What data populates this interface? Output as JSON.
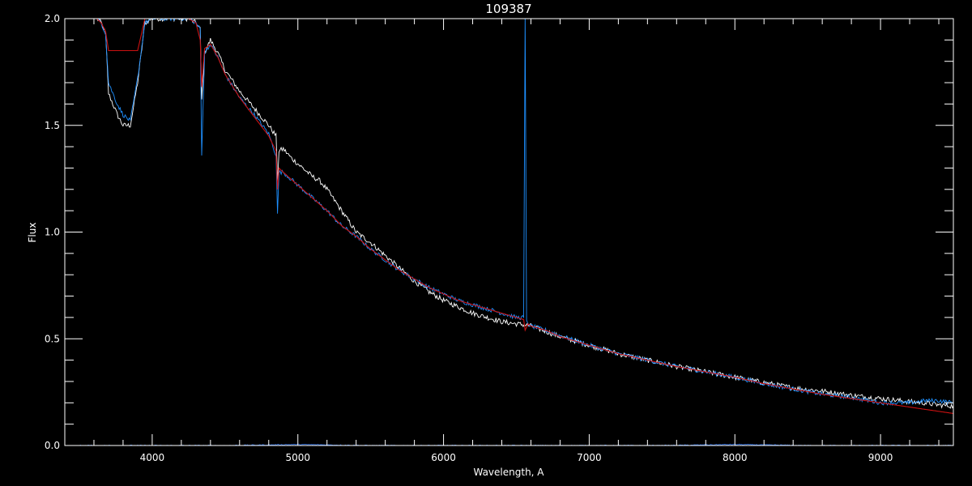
{
  "chart_data": {
    "type": "line",
    "title": "109387",
    "xlabel": "Wavelength, A",
    "ylabel": "Flux",
    "xlim": [
      3400,
      9500
    ],
    "ylim": [
      0.0,
      2.0
    ],
    "xticks": [
      {
        "value": 4000,
        "label": "4000"
      },
      {
        "value": 5000,
        "label": "5000"
      },
      {
        "value": 6000,
        "label": "6000"
      },
      {
        "value": 7000,
        "label": "7000"
      },
      {
        "value": 8000,
        "label": "8000"
      },
      {
        "value": 9000,
        "label": "9000"
      }
    ],
    "yticks": [
      {
        "value": 0.0,
        "label": "0.0"
      },
      {
        "value": 0.5,
        "label": "0.5"
      },
      {
        "value": 1.0,
        "label": "1.0"
      },
      {
        "value": 1.5,
        "label": "1.5"
      },
      {
        "value": 2.0,
        "label": "2.0"
      }
    ],
    "background": "#000000",
    "axis_color": "#ffffff",
    "grid": false,
    "series": [
      {
        "color": "#ffffff",
        "noise": 0.012,
        "x": [
          3620,
          3650,
          3680,
          3700,
          3730,
          3760,
          3800,
          3850,
          3900,
          3950,
          4000,
          4050,
          4100,
          4150,
          4200,
          4250,
          4300,
          4330,
          4340,
          4360,
          4400,
          4450,
          4500,
          4600,
          4700,
          4800,
          4850,
          4860,
          4870,
          4900,
          4950,
          5000,
          5050,
          5100,
          5150,
          5200,
          5250,
          5300,
          5400,
          5500,
          5600,
          5700,
          5800,
          5900,
          6000,
          6100,
          6200,
          6300,
          6400,
          6500,
          6560,
          6600,
          6700,
          6800,
          7000,
          7200,
          7400,
          7600,
          7800,
          8000,
          8200,
          8400,
          8600,
          8800,
          9000,
          9200,
          9300,
          9400,
          9500
        ],
        "y": [
          2.0,
          1.98,
          1.93,
          1.65,
          1.6,
          1.55,
          1.5,
          1.5,
          1.7,
          1.98,
          2.0,
          2.0,
          2.0,
          2.0,
          2.0,
          2.0,
          1.98,
          1.95,
          1.62,
          1.84,
          1.9,
          1.84,
          1.76,
          1.66,
          1.58,
          1.5,
          1.45,
          1.24,
          1.38,
          1.39,
          1.35,
          1.32,
          1.29,
          1.26,
          1.24,
          1.2,
          1.15,
          1.1,
          1.0,
          0.95,
          0.89,
          0.83,
          0.77,
          0.72,
          0.68,
          0.65,
          0.62,
          0.6,
          0.58,
          0.57,
          0.565,
          0.56,
          0.535,
          0.51,
          0.47,
          0.43,
          0.4,
          0.37,
          0.345,
          0.32,
          0.295,
          0.27,
          0.255,
          0.235,
          0.22,
          0.205,
          0.2,
          0.19,
          0.185
        ]
      },
      {
        "color": "#1e90ff",
        "noise": 0.01,
        "x": [
          3620,
          3650,
          3680,
          3700,
          3730,
          3760,
          3800,
          3850,
          3900,
          3950,
          4000,
          4050,
          4100,
          4150,
          4200,
          4250,
          4300,
          4330,
          4340,
          4360,
          4400,
          4450,
          4500,
          4600,
          4700,
          4800,
          4850,
          4860,
          4870,
          4900,
          4950,
          5000,
          5100,
          5200,
          5300,
          5400,
          5500,
          5600,
          5700,
          5800,
          5900,
          6000,
          6100,
          6200,
          6300,
          6400,
          6500,
          6550,
          6560,
          6570,
          6600,
          6700,
          6800,
          7000,
          7200,
          7400,
          7600,
          7800,
          8000,
          8200,
          8400,
          8600,
          8800,
          9000,
          9200,
          9300,
          9400,
          9500
        ],
        "y": [
          2.0,
          1.98,
          1.93,
          1.7,
          1.65,
          1.6,
          1.55,
          1.52,
          1.72,
          1.98,
          2.0,
          2.0,
          2.0,
          2.0,
          2.0,
          2.0,
          1.98,
          1.95,
          1.36,
          1.84,
          1.88,
          1.82,
          1.74,
          1.63,
          1.55,
          1.46,
          1.36,
          1.08,
          1.28,
          1.28,
          1.25,
          1.22,
          1.16,
          1.1,
          1.03,
          0.98,
          0.92,
          0.87,
          0.82,
          0.78,
          0.74,
          0.71,
          0.68,
          0.66,
          0.64,
          0.62,
          0.6,
          0.6,
          2.0,
          0.58,
          0.56,
          0.54,
          0.515,
          0.47,
          0.43,
          0.4,
          0.37,
          0.345,
          0.32,
          0.29,
          0.265,
          0.24,
          0.225,
          0.2,
          0.2,
          0.21,
          0.21,
          0.2
        ]
      },
      {
        "color": "#cc1111",
        "noise": 0,
        "x": [
          3620,
          3650,
          3680,
          3700,
          3750,
          3800,
          3850,
          3900,
          3950,
          4000,
          4050,
          4100,
          4150,
          4200,
          4250,
          4300,
          4330,
          4340,
          4360,
          4400,
          4450,
          4500,
          4600,
          4700,
          4800,
          4850,
          4860,
          4870,
          4900,
          5000,
          5100,
          5200,
          5300,
          5400,
          5500,
          5600,
          5700,
          5800,
          5900,
          6000,
          6100,
          6200,
          6300,
          6400,
          6500,
          6550,
          6560,
          6580,
          6600,
          6700,
          6800,
          7000,
          7200,
          7400,
          7600,
          7800,
          8000,
          8200,
          8400,
          8600,
          8800,
          9000,
          9200,
          9400,
          9500
        ],
        "y": [
          2.0,
          1.98,
          1.94,
          1.85,
          1.85,
          1.85,
          1.85,
          1.85,
          2.0,
          2.0,
          2.0,
          2.0,
          2.0,
          2.0,
          2.0,
          1.98,
          1.9,
          1.68,
          1.86,
          1.88,
          1.82,
          1.74,
          1.63,
          1.54,
          1.45,
          1.38,
          1.2,
          1.3,
          1.28,
          1.22,
          1.16,
          1.1,
          1.03,
          0.98,
          0.92,
          0.87,
          0.82,
          0.78,
          0.74,
          0.71,
          0.68,
          0.66,
          0.64,
          0.62,
          0.6,
          0.59,
          0.54,
          0.57,
          0.56,
          0.54,
          0.51,
          0.47,
          0.43,
          0.4,
          0.37,
          0.345,
          0.32,
          0.29,
          0.265,
          0.24,
          0.22,
          0.2,
          0.18,
          0.16,
          0.15
        ]
      },
      {
        "color": "#1e5fd0",
        "noise": 0.002,
        "x": [
          3500,
          4000,
          4500,
          5000,
          5500,
          6000,
          6500,
          7000,
          7500,
          8000,
          8500,
          9000,
          9500
        ],
        "y": [
          0.0,
          0.0,
          0.0,
          0.005,
          0.0,
          0.0,
          0.0,
          0.0,
          0.0,
          0.005,
          0.0,
          0.0,
          0.0
        ]
      }
    ]
  }
}
